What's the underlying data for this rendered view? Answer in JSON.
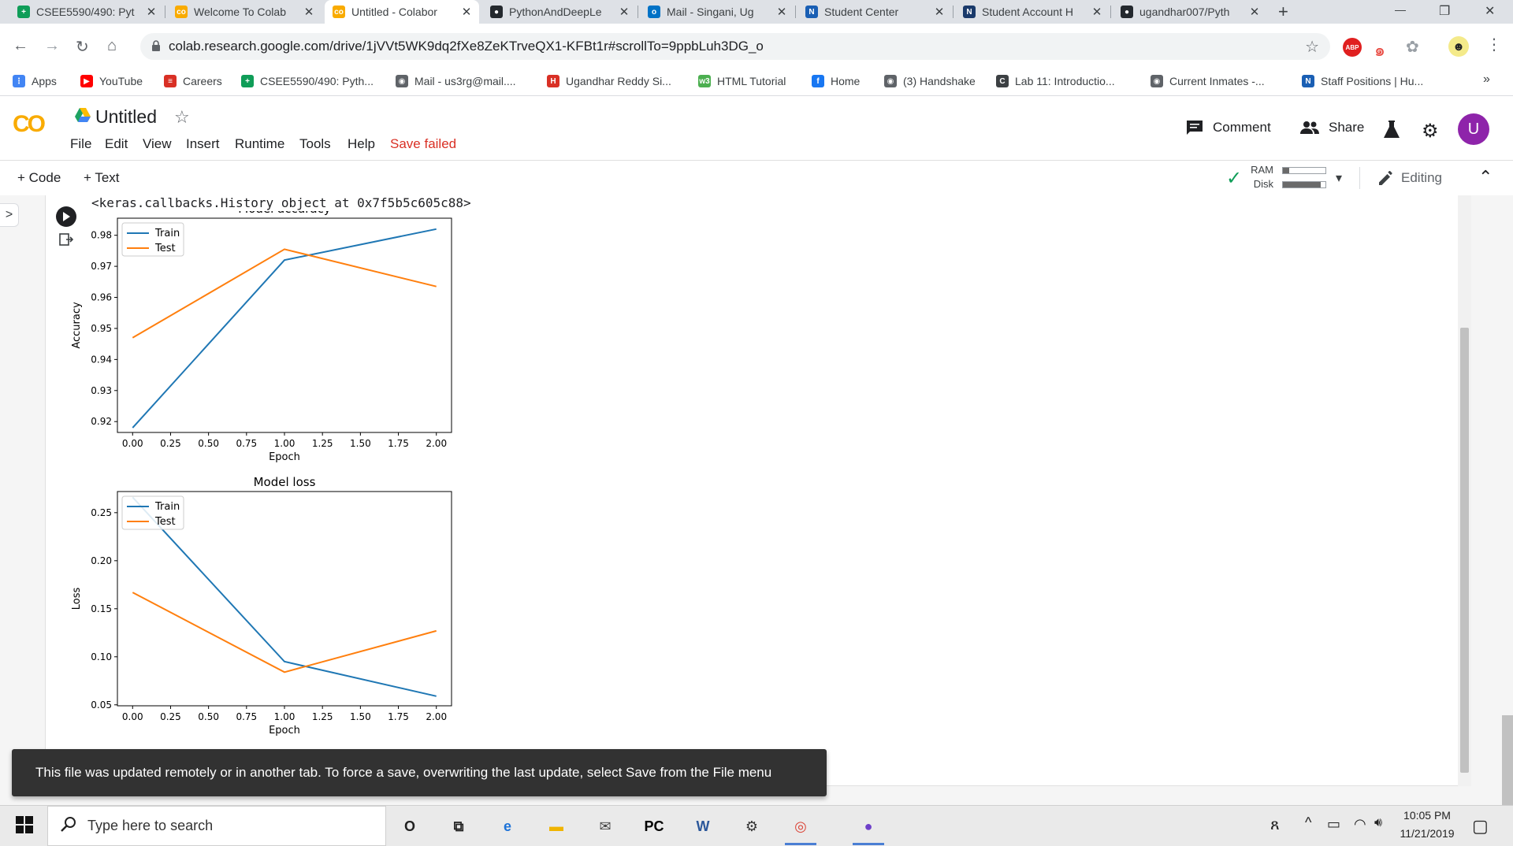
{
  "tabs": [
    {
      "title": "CSEE5590/490: Pyt",
      "fav_color": "#0f9d58",
      "fav_glyph": "+"
    },
    {
      "title": "Welcome To Colab",
      "fav_color": "#f9ab00",
      "fav_glyph": "co"
    },
    {
      "title": "Untitled - Colabor",
      "fav_color": "#f9ab00",
      "fav_glyph": "co"
    },
    {
      "title": "PythonAndDeepLe",
      "fav_color": "#24292e",
      "fav_glyph": "●"
    },
    {
      "title": "Mail - Singani, Ug",
      "fav_color": "#0072c6",
      "fav_glyph": "o"
    },
    {
      "title": "Student Center",
      "fav_color": "#1a5fb4",
      "fav_glyph": "N"
    },
    {
      "title": "Student Account H",
      "fav_color": "#1a3a6b",
      "fav_glyph": "N"
    },
    {
      "title": "ugandhar007/Pyth",
      "fav_color": "#24292e",
      "fav_glyph": "●"
    }
  ],
  "new_tab": "+",
  "window": {
    "minimize": "—",
    "restore": "❐",
    "close": "✕"
  },
  "nav": {
    "back": "←",
    "forward": "→",
    "reload": "↻",
    "home": "⌂"
  },
  "url": "colab.research.google.com/drive/1jVVt5WK9dq2fXe8ZeKTrveQX1-KFBt1r#scrollTo=9ppbLuh3DG_o",
  "ext": {
    "abp": "ABP"
  },
  "bookmarks": [
    {
      "label": "Apps",
      "color": "#4285f4",
      "glyph": "⋮"
    },
    {
      "label": "YouTube",
      "color": "#ff0000",
      "glyph": "▶"
    },
    {
      "label": "Careers",
      "color": "#d93025",
      "glyph": "≡"
    },
    {
      "label": "CSEE5590/490: Pyth...",
      "color": "#0f9d58",
      "glyph": "+"
    },
    {
      "label": "Mail - us3rg@mail....",
      "color": "#5f6368",
      "glyph": "◉"
    },
    {
      "label": "Ugandhar Reddy Si...",
      "color": "#d93025",
      "glyph": "H"
    },
    {
      "label": "HTML Tutorial",
      "color": "#4caf50",
      "glyph": "w3"
    },
    {
      "label": "Home",
      "color": "#1877f2",
      "glyph": "f"
    },
    {
      "label": "(3) Handshake",
      "color": "#5f6368",
      "glyph": "◉"
    },
    {
      "label": "Lab 11: Introductio...",
      "color": "#3c4043",
      "glyph": "C"
    },
    {
      "label": "Current Inmates -...",
      "color": "#5f6368",
      "glyph": "◉"
    },
    {
      "label": "Staff Positions | Hu...",
      "color": "#1a5fb4",
      "glyph": "N"
    }
  ],
  "bookmarks_more": "»",
  "colab": {
    "logo": "CO",
    "title": "Untitled",
    "star": "☆",
    "menu": [
      "File",
      "Edit",
      "View",
      "Insert",
      "Runtime",
      "Tools",
      "Help"
    ],
    "save_failed": "Save failed",
    "comment": "Comment",
    "share": "Share",
    "avatar": "U",
    "add_code": "+ Code",
    "add_text": "+ Text",
    "ram": "RAM",
    "disk": "Disk",
    "editing": "Editing",
    "check": "✓",
    "caret": "▾",
    "collapse": "⌃",
    "sidebar_toggle": ">"
  },
  "output_text": "<keras.callbacks.History object at 0x7f5b5c605c88>",
  "chart_data": [
    {
      "type": "line",
      "title": "Model accuracy",
      "xlabel": "Epoch",
      "ylabel": "Accuracy",
      "x": [
        0,
        1,
        2
      ],
      "xticks": [
        "0.00",
        "0.25",
        "0.50",
        "0.75",
        "1.00",
        "1.25",
        "1.50",
        "1.75",
        "2.00"
      ],
      "yticks": [
        "0.92",
        "0.93",
        "0.94",
        "0.95",
        "0.96",
        "0.97",
        "0.98"
      ],
      "xlim": [
        -0.1,
        2.1
      ],
      "ylim": [
        0.9165,
        0.9855
      ],
      "legend": "upper-left",
      "series": [
        {
          "name": "Train",
          "color": "#1f77b4",
          "values": [
            0.918,
            0.972,
            0.982
          ]
        },
        {
          "name": "Test",
          "color": "#ff7f0e",
          "values": [
            0.947,
            0.9755,
            0.9635
          ]
        }
      ]
    },
    {
      "type": "line",
      "title": "Model loss",
      "xlabel": "Epoch",
      "ylabel": "Loss",
      "x": [
        0,
        1,
        2
      ],
      "xticks": [
        "0.00",
        "0.25",
        "0.50",
        "0.75",
        "1.00",
        "1.25",
        "1.50",
        "1.75",
        "2.00"
      ],
      "yticks": [
        "0.05",
        "0.10",
        "0.15",
        "0.20",
        "0.25"
      ],
      "xlim": [
        -0.1,
        2.1
      ],
      "ylim": [
        0.049,
        0.272
      ],
      "legend": "upper-left",
      "series": [
        {
          "name": "Train",
          "color": "#1f77b4",
          "values": [
            0.266,
            0.095,
            0.059
          ]
        },
        {
          "name": "Test",
          "color": "#ff7f0e",
          "values": [
            0.167,
            0.084,
            0.127
          ]
        }
      ]
    }
  ],
  "snackbar": "This file was updated remotely or in another tab. To force a save, overwriting the last update, select Save from the File menu",
  "taskbar": {
    "start": "⊞",
    "search_placeholder": "Type here to search",
    "time": "10:05 PM",
    "date": "11/21/2019",
    "apps": [
      {
        "name": "cortana",
        "glyph": "O",
        "color": "#222"
      },
      {
        "name": "task-view",
        "glyph": "⧉",
        "color": "#222"
      },
      {
        "name": "edge",
        "glyph": "e",
        "color": "#1e73d8"
      },
      {
        "name": "explorer",
        "glyph": "▬",
        "color": "#f0b400"
      },
      {
        "name": "mail",
        "glyph": "✉",
        "color": "#444"
      },
      {
        "name": "pycharm",
        "glyph": "PC",
        "color": "#000"
      },
      {
        "name": "word",
        "glyph": "W",
        "color": "#2b579a"
      },
      {
        "name": "settings",
        "glyph": "⚙",
        "color": "#333"
      },
      {
        "name": "chrome",
        "glyph": "◎",
        "color": "#db4437"
      },
      {
        "name": "github",
        "glyph": "●",
        "color": "#6e40c9"
      }
    ],
    "tray": {
      "people": "ጸ",
      "chevron": "^",
      "battery": "▭",
      "wifi": "◠",
      "volume": "🔊︎",
      "notify": "▢"
    }
  }
}
